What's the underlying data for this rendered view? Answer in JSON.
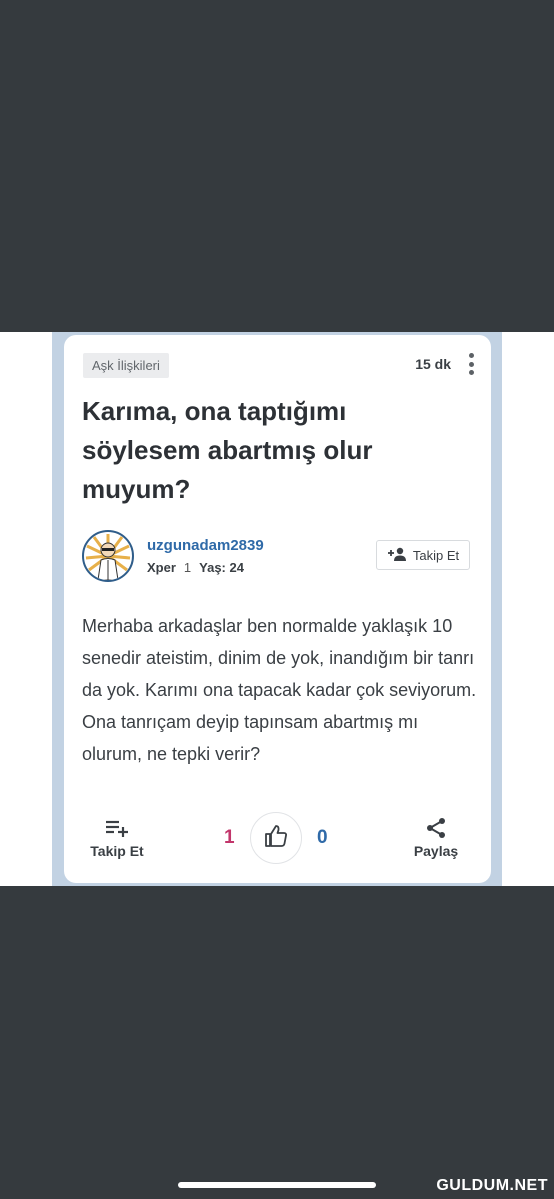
{
  "post": {
    "category": "Aşk İlişkileri",
    "time_ago": "15 dk",
    "title": "Karıma, ona taptığımı söylesem abartmış olur muyum?",
    "author": {
      "username": "uzgunadam2839",
      "rank": "Xper",
      "level": "1",
      "age_text": "Yaş: 24"
    },
    "follow_user_label": "Takip Et",
    "body": "Merhaba arkadaşlar ben normalde yaklaşık 10 senedir ateistim, dinim de yok, inandığım bir tanrı da yok. Karımı ona tapacak kadar çok seviyorum. Ona tanrıçam deyip tapınsam abartmış mı olurum, ne tepki verir?"
  },
  "actions": {
    "follow_label": "Takip Et",
    "upvotes": "1",
    "downvotes": "0",
    "share_label": "Paylaş"
  },
  "watermark": "GULDUM.NET",
  "colors": {
    "accent_blue": "#2f6aa8",
    "upvote_pink": "#c2366b",
    "background_dark": "#353a3e"
  },
  "icons": [
    "more-vertical-icon",
    "add-user-icon",
    "playlist-add-icon",
    "thumbs-up-icon",
    "share-icon"
  ]
}
